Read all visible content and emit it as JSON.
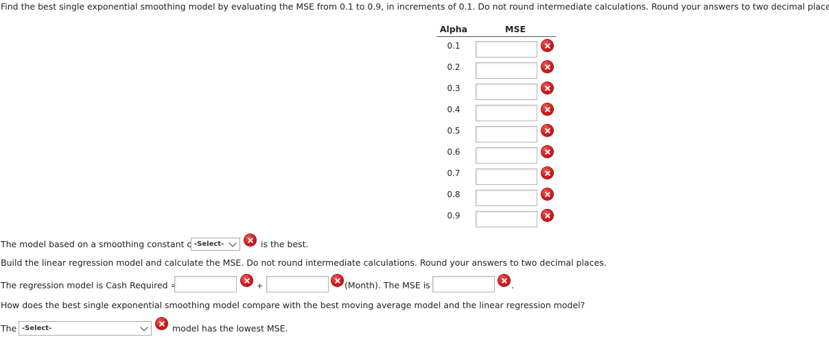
{
  "instructions": "Find the best single exponential smoothing model by evaluating the MSE from 0.1 to 0.9, in increments of 0.1. Do not round intermediate calculations. Round your answers to two decimal places.",
  "table": {
    "alpha_header": "Alpha",
    "mse_header": "MSE",
    "rows": [
      {
        "alpha": "0.1",
        "mse": ""
      },
      {
        "alpha": "0.2",
        "mse": ""
      },
      {
        "alpha": "0.3",
        "mse": ""
      },
      {
        "alpha": "0.4",
        "mse": ""
      },
      {
        "alpha": "0.5",
        "mse": ""
      },
      {
        "alpha": "0.6",
        "mse": ""
      },
      {
        "alpha": "0.7",
        "mse": ""
      },
      {
        "alpha": "0.8",
        "mse": ""
      },
      {
        "alpha": "0.9",
        "mse": ""
      }
    ]
  },
  "smoothing": {
    "prefix": "The model based on a smoothing constant of",
    "select_value": "-Select-",
    "suffix": "is the best."
  },
  "regression_instructions": "Build the linear regression model and calculate the MSE. Do not round intermediate calculations. Round your answers to two decimal places.",
  "regression": {
    "prefix": "The regression model is Cash Required =",
    "intercept_value": "",
    "plus": "+",
    "slope_value": "",
    "month_text": "(Month). The MSE is",
    "mse_value": "",
    "end": "."
  },
  "compare_question": "How does the best single exponential smoothing model compare with the best moving average model and the linear regression model?",
  "conclusion": {
    "prefix": "The",
    "select_value": "-Select-",
    "suffix": "model has the lowest MSE."
  },
  "colors": {
    "incorrect_icon": "#d41818",
    "input_border": "#b5b5b5"
  },
  "icons": {
    "incorrect": "x-circle-icon",
    "dropdown": "chevron-down-icon"
  }
}
